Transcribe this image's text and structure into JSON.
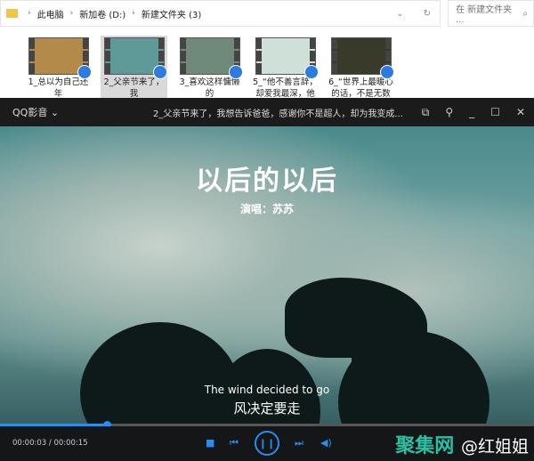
{
  "explorer": {
    "breadcrumb": [
      "此电脑",
      "新加卷 (D:)",
      "新建文件夹 (3)"
    ],
    "search_placeholder": "在 新建文件夹 ...",
    "files": [
      {
        "line1": "1_总以为自己还年",
        "line2": "轻.mp4",
        "thumb": "#b38a4a",
        "selected": false
      },
      {
        "line1": "2_父亲节来了，我",
        "line2": "想告诉爸爸，感谢",
        "thumb": "#5f9a98",
        "selected": true
      },
      {
        "line1": "3_喜欢这样慵懒的",
        "line2": "午后，温柔的风",
        "thumb": "#6f8a7a",
        "selected": false
      },
      {
        "line1": "5_“他不善言辞，",
        "line2": "却爱我最深，他不",
        "thumb": "#cfe0d8",
        "selected": false
      },
      {
        "line1": "6_“世界上最暖心",
        "line2": "的话，不是无数的",
        "thumb": "#3a3a2a",
        "selected": false
      }
    ]
  },
  "player": {
    "app_name": "QQ影音",
    "title": "2_父亲节来了，我想告诉爸爸，感谢你不是超人，却为我变成...",
    "video_title": "以后的以后",
    "singer": "演唱：苏苏",
    "subtitle_en": "The wind decided to go",
    "subtitle_zh": "风决定要走",
    "time": "00:00:03 / 00:00:15",
    "progress": 0.2,
    "accent": "#1e90ff"
  },
  "watermark": {
    "brand": "聚集网",
    "handle": "@红姐姐"
  }
}
